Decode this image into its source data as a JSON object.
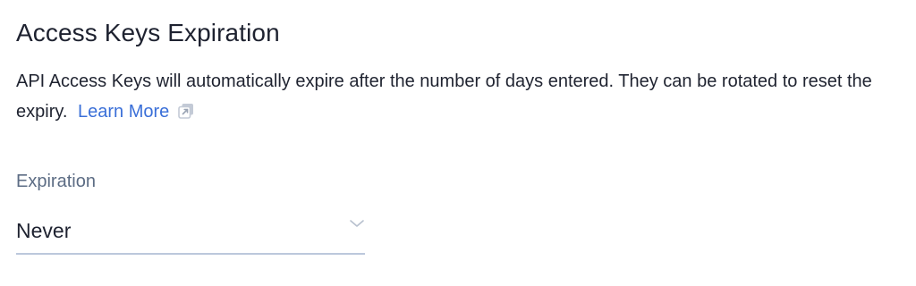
{
  "section": {
    "title": "Access Keys Expiration",
    "description": "API Access Keys will automatically expire after the number of days entered. They can be rotated to reset the expiry.",
    "learn_more_label": "Learn More"
  },
  "expiration_field": {
    "label": "Expiration",
    "selected_value": "Never"
  },
  "icons": {
    "external_link": "external-link-icon",
    "dropdown": "chevron-down-icon"
  },
  "colors": {
    "link": "#3a6fd8",
    "label": "#5c6c84",
    "underline": "#bcc8dc",
    "text": "#1f2330"
  }
}
